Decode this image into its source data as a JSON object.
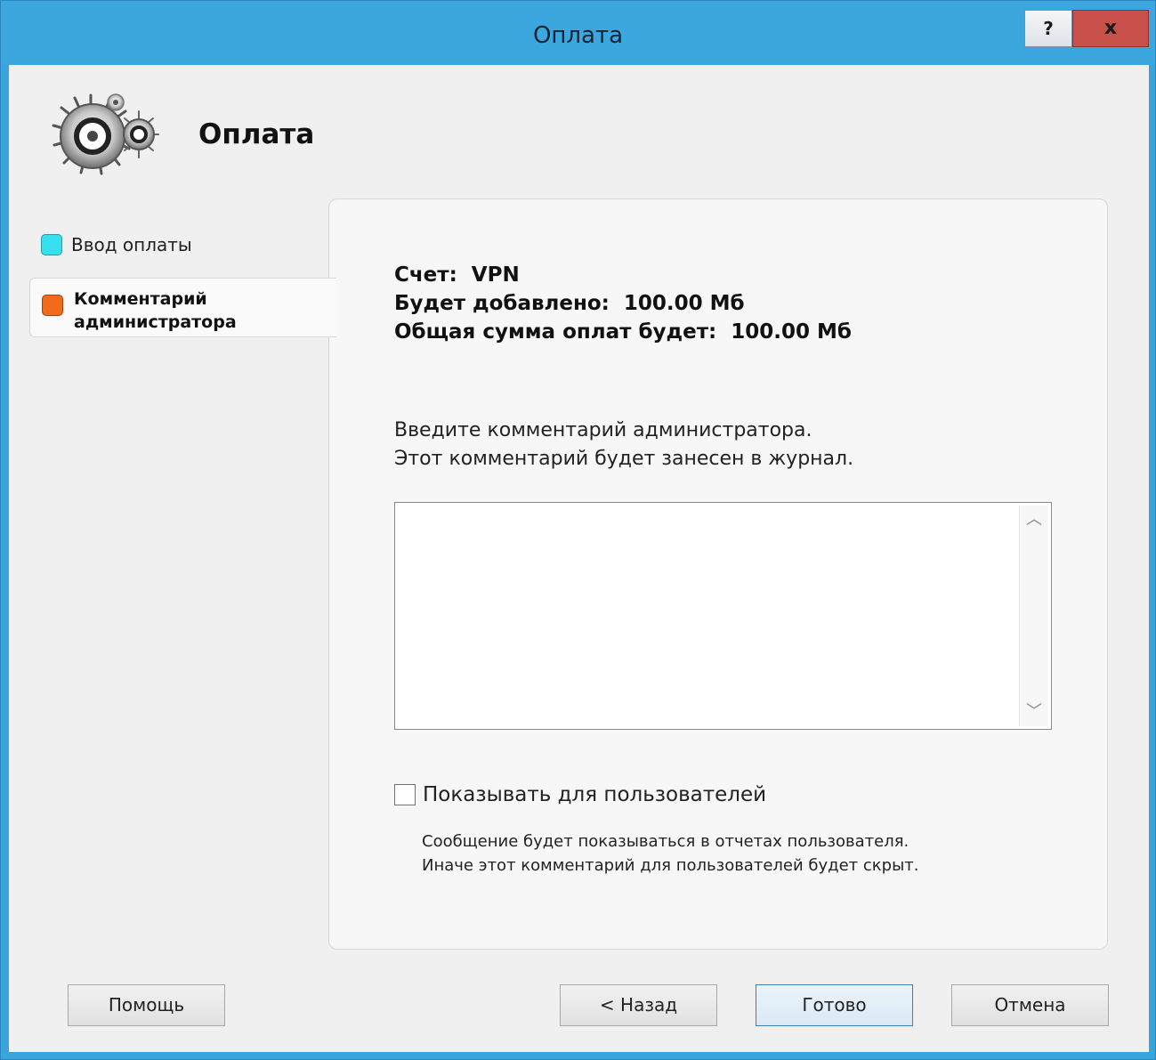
{
  "window": {
    "title": "Оплата",
    "help_glyph": "?",
    "close_glyph": "x",
    "accent_color": "#3ca6de"
  },
  "header": {
    "title": "Оплата",
    "logo_icon": "gears-icon"
  },
  "steps": [
    {
      "label": "Ввод оплаты",
      "color": "#36e0ef"
    },
    {
      "label": "Комментарий\nадминистратора",
      "color": "#f26a1b"
    }
  ],
  "info": {
    "account": "Счет:  VPN",
    "added": "Будет добавлено:  100.00 Мб",
    "total": "Общая сумма оплат будет:  100.00 Мб"
  },
  "comment": {
    "prompt_line1": "Введите комментарий администратора.",
    "prompt_line2": "Этот комментарий будет занесен в журнал.",
    "value": ""
  },
  "show_users": {
    "label": "Показывать для пользователей",
    "checked": false,
    "note_line1": "Сообщение будет показываться в отчетах пользователя.",
    "note_line2": "Иначе этот комментарий для пользователей будет скрыт."
  },
  "buttons": {
    "help": "Помощь",
    "back": "< Назад",
    "done": "Готово",
    "cancel": "Отмена"
  }
}
